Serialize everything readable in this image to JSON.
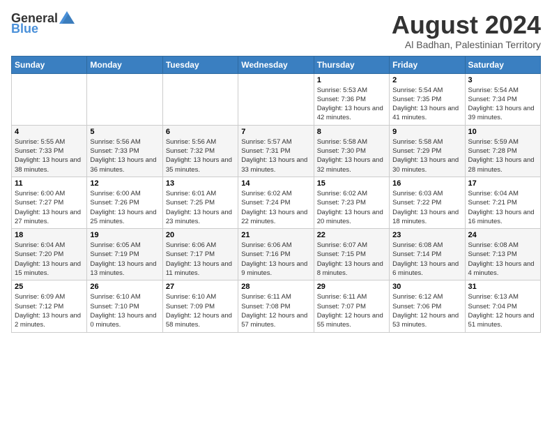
{
  "logo": {
    "text_general": "General",
    "text_blue": "Blue"
  },
  "title": "August 2024",
  "subtitle": "Al Badhan, Palestinian Territory",
  "days_of_week": [
    "Sunday",
    "Monday",
    "Tuesday",
    "Wednesday",
    "Thursday",
    "Friday",
    "Saturday"
  ],
  "weeks": [
    {
      "days": [
        {
          "number": "",
          "sunrise": "",
          "sunset": "",
          "daylight": "",
          "empty": true
        },
        {
          "number": "",
          "sunrise": "",
          "sunset": "",
          "daylight": "",
          "empty": true
        },
        {
          "number": "",
          "sunrise": "",
          "sunset": "",
          "daylight": "",
          "empty": true
        },
        {
          "number": "",
          "sunrise": "",
          "sunset": "",
          "daylight": "",
          "empty": true
        },
        {
          "number": "1",
          "sunrise": "Sunrise: 5:53 AM",
          "sunset": "Sunset: 7:36 PM",
          "daylight": "Daylight: 13 hours and 42 minutes.",
          "empty": false
        },
        {
          "number": "2",
          "sunrise": "Sunrise: 5:54 AM",
          "sunset": "Sunset: 7:35 PM",
          "daylight": "Daylight: 13 hours and 41 minutes.",
          "empty": false
        },
        {
          "number": "3",
          "sunrise": "Sunrise: 5:54 AM",
          "sunset": "Sunset: 7:34 PM",
          "daylight": "Daylight: 13 hours and 39 minutes.",
          "empty": false
        }
      ]
    },
    {
      "days": [
        {
          "number": "4",
          "sunrise": "Sunrise: 5:55 AM",
          "sunset": "Sunset: 7:33 PM",
          "daylight": "Daylight: 13 hours and 38 minutes.",
          "empty": false
        },
        {
          "number": "5",
          "sunrise": "Sunrise: 5:56 AM",
          "sunset": "Sunset: 7:33 PM",
          "daylight": "Daylight: 13 hours and 36 minutes.",
          "empty": false
        },
        {
          "number": "6",
          "sunrise": "Sunrise: 5:56 AM",
          "sunset": "Sunset: 7:32 PM",
          "daylight": "Daylight: 13 hours and 35 minutes.",
          "empty": false
        },
        {
          "number": "7",
          "sunrise": "Sunrise: 5:57 AM",
          "sunset": "Sunset: 7:31 PM",
          "daylight": "Daylight: 13 hours and 33 minutes.",
          "empty": false
        },
        {
          "number": "8",
          "sunrise": "Sunrise: 5:58 AM",
          "sunset": "Sunset: 7:30 PM",
          "daylight": "Daylight: 13 hours and 32 minutes.",
          "empty": false
        },
        {
          "number": "9",
          "sunrise": "Sunrise: 5:58 AM",
          "sunset": "Sunset: 7:29 PM",
          "daylight": "Daylight: 13 hours and 30 minutes.",
          "empty": false
        },
        {
          "number": "10",
          "sunrise": "Sunrise: 5:59 AM",
          "sunset": "Sunset: 7:28 PM",
          "daylight": "Daylight: 13 hours and 28 minutes.",
          "empty": false
        }
      ]
    },
    {
      "days": [
        {
          "number": "11",
          "sunrise": "Sunrise: 6:00 AM",
          "sunset": "Sunset: 7:27 PM",
          "daylight": "Daylight: 13 hours and 27 minutes.",
          "empty": false
        },
        {
          "number": "12",
          "sunrise": "Sunrise: 6:00 AM",
          "sunset": "Sunset: 7:26 PM",
          "daylight": "Daylight: 13 hours and 25 minutes.",
          "empty": false
        },
        {
          "number": "13",
          "sunrise": "Sunrise: 6:01 AM",
          "sunset": "Sunset: 7:25 PM",
          "daylight": "Daylight: 13 hours and 23 minutes.",
          "empty": false
        },
        {
          "number": "14",
          "sunrise": "Sunrise: 6:02 AM",
          "sunset": "Sunset: 7:24 PM",
          "daylight": "Daylight: 13 hours and 22 minutes.",
          "empty": false
        },
        {
          "number": "15",
          "sunrise": "Sunrise: 6:02 AM",
          "sunset": "Sunset: 7:23 PM",
          "daylight": "Daylight: 13 hours and 20 minutes.",
          "empty": false
        },
        {
          "number": "16",
          "sunrise": "Sunrise: 6:03 AM",
          "sunset": "Sunset: 7:22 PM",
          "daylight": "Daylight: 13 hours and 18 minutes.",
          "empty": false
        },
        {
          "number": "17",
          "sunrise": "Sunrise: 6:04 AM",
          "sunset": "Sunset: 7:21 PM",
          "daylight": "Daylight: 13 hours and 16 minutes.",
          "empty": false
        }
      ]
    },
    {
      "days": [
        {
          "number": "18",
          "sunrise": "Sunrise: 6:04 AM",
          "sunset": "Sunset: 7:20 PM",
          "daylight": "Daylight: 13 hours and 15 minutes.",
          "empty": false
        },
        {
          "number": "19",
          "sunrise": "Sunrise: 6:05 AM",
          "sunset": "Sunset: 7:19 PM",
          "daylight": "Daylight: 13 hours and 13 minutes.",
          "empty": false
        },
        {
          "number": "20",
          "sunrise": "Sunrise: 6:06 AM",
          "sunset": "Sunset: 7:17 PM",
          "daylight": "Daylight: 13 hours and 11 minutes.",
          "empty": false
        },
        {
          "number": "21",
          "sunrise": "Sunrise: 6:06 AM",
          "sunset": "Sunset: 7:16 PM",
          "daylight": "Daylight: 13 hours and 9 minutes.",
          "empty": false
        },
        {
          "number": "22",
          "sunrise": "Sunrise: 6:07 AM",
          "sunset": "Sunset: 7:15 PM",
          "daylight": "Daylight: 13 hours and 8 minutes.",
          "empty": false
        },
        {
          "number": "23",
          "sunrise": "Sunrise: 6:08 AM",
          "sunset": "Sunset: 7:14 PM",
          "daylight": "Daylight: 13 hours and 6 minutes.",
          "empty": false
        },
        {
          "number": "24",
          "sunrise": "Sunrise: 6:08 AM",
          "sunset": "Sunset: 7:13 PM",
          "daylight": "Daylight: 13 hours and 4 minutes.",
          "empty": false
        }
      ]
    },
    {
      "days": [
        {
          "number": "25",
          "sunrise": "Sunrise: 6:09 AM",
          "sunset": "Sunset: 7:12 PM",
          "daylight": "Daylight: 13 hours and 2 minutes.",
          "empty": false
        },
        {
          "number": "26",
          "sunrise": "Sunrise: 6:10 AM",
          "sunset": "Sunset: 7:10 PM",
          "daylight": "Daylight: 13 hours and 0 minutes.",
          "empty": false
        },
        {
          "number": "27",
          "sunrise": "Sunrise: 6:10 AM",
          "sunset": "Sunset: 7:09 PM",
          "daylight": "Daylight: 12 hours and 58 minutes.",
          "empty": false
        },
        {
          "number": "28",
          "sunrise": "Sunrise: 6:11 AM",
          "sunset": "Sunset: 7:08 PM",
          "daylight": "Daylight: 12 hours and 57 minutes.",
          "empty": false
        },
        {
          "number": "29",
          "sunrise": "Sunrise: 6:11 AM",
          "sunset": "Sunset: 7:07 PM",
          "daylight": "Daylight: 12 hours and 55 minutes.",
          "empty": false
        },
        {
          "number": "30",
          "sunrise": "Sunrise: 6:12 AM",
          "sunset": "Sunset: 7:06 PM",
          "daylight": "Daylight: 12 hours and 53 minutes.",
          "empty": false
        },
        {
          "number": "31",
          "sunrise": "Sunrise: 6:13 AM",
          "sunset": "Sunset: 7:04 PM",
          "daylight": "Daylight: 12 hours and 51 minutes.",
          "empty": false
        }
      ]
    }
  ]
}
